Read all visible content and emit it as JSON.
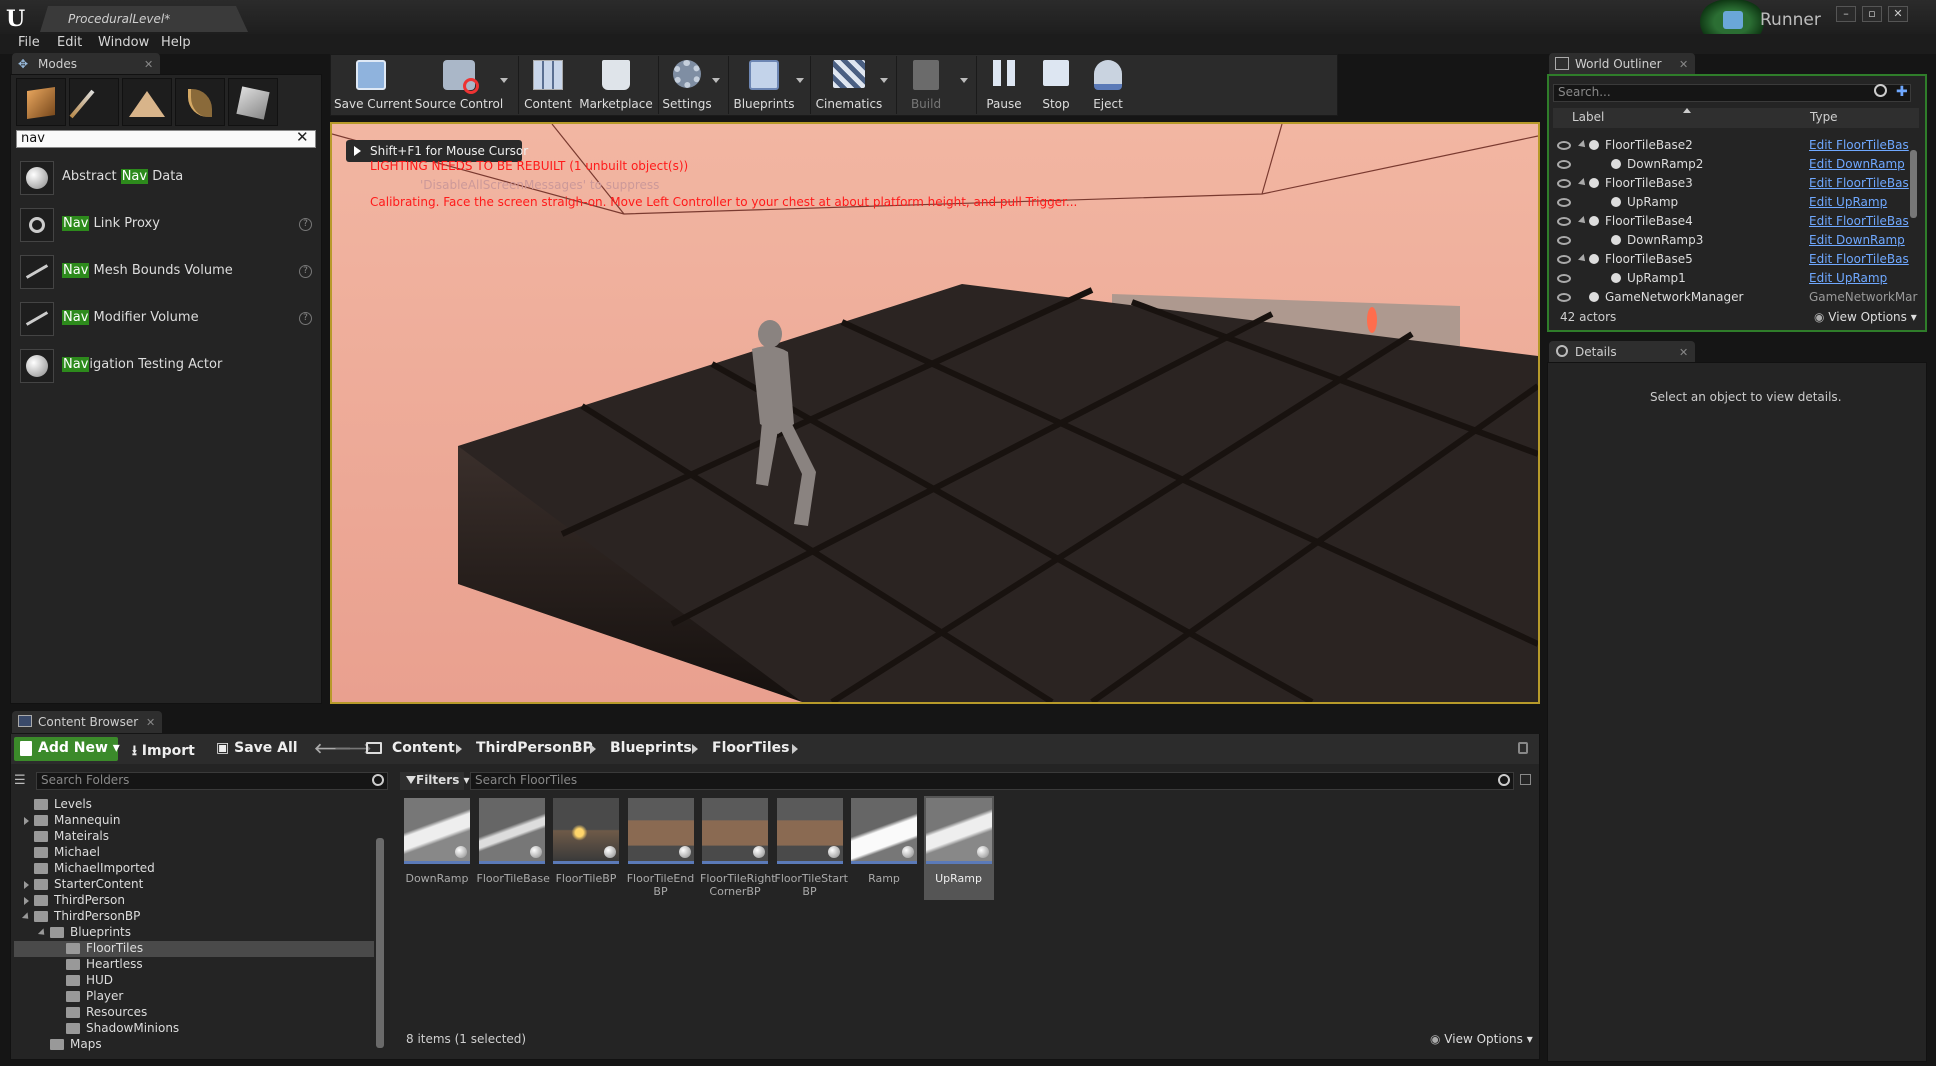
{
  "app": {
    "doc_tab": "ProceduralLevel*",
    "play_label": "Runner"
  },
  "menu": [
    "File",
    "Edit",
    "Window",
    "Help"
  ],
  "modes": {
    "tab": "Modes",
    "search_value": "nav",
    "items": [
      {
        "pre": "Abstract ",
        "hl": "Nav",
        "post": " Data",
        "help": false
      },
      {
        "pre": "",
        "hl": "Nav",
        "post": " Link Proxy",
        "help": true
      },
      {
        "pre": "",
        "hl": "Nav",
        "post": " Mesh Bounds Volume",
        "help": true
      },
      {
        "pre": "",
        "hl": "Nav",
        "post": " Modifier Volume",
        "help": true
      },
      {
        "pre": "",
        "hl": "Nav",
        "post": "igation Testing Actor",
        "help": false
      }
    ]
  },
  "toolbar": {
    "save_current": "Save Current",
    "source_control": "Source Control",
    "content": "Content",
    "marketplace": "Marketplace",
    "settings": "Settings",
    "blueprints": "Blueprints",
    "cinematics": "Cinematics",
    "build": "Build",
    "pause": "Pause",
    "stop": "Stop",
    "eject": "Eject"
  },
  "viewport": {
    "hint": "Shift+F1 for Mouse Cursor",
    "msg_lighting": "LIGHTING NEEDS TO BE REBUILT (1 unbuilt object(s))",
    "msg_disable": "'DisableAllScreenMessages' to suppress",
    "msg_calibrating": "Calibrating. Face the screen straigh-on. Move Left Controller to your chest at about platform height, and pull Trigger..."
  },
  "outliner": {
    "tab": "World Outliner",
    "search_placeholder": "Search...",
    "col_label": "Label",
    "col_type": "Type",
    "rows": [
      {
        "name": "FloorTileBase2",
        "type": "Edit FloorTileBas",
        "indent": 1,
        "link": true
      },
      {
        "name": "DownRamp2",
        "type": "Edit DownRamp",
        "indent": 2,
        "link": true
      },
      {
        "name": "FloorTileBase3",
        "type": "Edit FloorTileBas",
        "indent": 1,
        "link": true
      },
      {
        "name": "UpRamp",
        "type": "Edit UpRamp",
        "indent": 2,
        "link": true
      },
      {
        "name": "FloorTileBase4",
        "type": "Edit FloorTileBas",
        "indent": 1,
        "link": true
      },
      {
        "name": "DownRamp3",
        "type": "Edit DownRamp",
        "indent": 2,
        "link": true
      },
      {
        "name": "FloorTileBase5",
        "type": "Edit FloorTileBas",
        "indent": 1,
        "link": true
      },
      {
        "name": "UpRamp1",
        "type": "Edit UpRamp",
        "indent": 2,
        "link": true
      },
      {
        "name": "GameNetworkManager",
        "type": "GameNetworkMar",
        "indent": 1,
        "link": false
      }
    ],
    "actor_count": "42 actors",
    "view_options": "View Options"
  },
  "details": {
    "tab": "Details",
    "empty_text": "Select an object to view details."
  },
  "content_browser": {
    "tab": "Content Browser",
    "add_new": "Add New",
    "import": "Import",
    "save_all": "Save All",
    "breadcrumb": [
      "Content",
      "ThirdPersonBP",
      "Blueprints",
      "FloorTiles"
    ],
    "folder_search_placeholder": "Search Folders",
    "filters": "Filters",
    "asset_search_placeholder": "Search FloorTiles",
    "folders": [
      {
        "name": "Levels",
        "depth": 0,
        "arrow": false,
        "open": false,
        "selected": false
      },
      {
        "name": "Mannequin",
        "depth": 0,
        "arrow": true,
        "open": false,
        "selected": false
      },
      {
        "name": "Mateirals",
        "depth": 0,
        "arrow": false,
        "open": false,
        "selected": false
      },
      {
        "name": "Michael",
        "depth": 0,
        "arrow": false,
        "open": false,
        "selected": false
      },
      {
        "name": "MichaelImported",
        "depth": 0,
        "arrow": false,
        "open": false,
        "selected": false
      },
      {
        "name": "StarterContent",
        "depth": 0,
        "arrow": true,
        "open": false,
        "selected": false
      },
      {
        "name": "ThirdPerson",
        "depth": 0,
        "arrow": true,
        "open": false,
        "selected": false
      },
      {
        "name": "ThirdPersonBP",
        "depth": 0,
        "arrow": true,
        "open": true,
        "selected": false
      },
      {
        "name": "Blueprints",
        "depth": 1,
        "arrow": true,
        "open": true,
        "selected": false
      },
      {
        "name": "FloorTiles",
        "depth": 2,
        "arrow": false,
        "open": false,
        "selected": true
      },
      {
        "name": "Heartless",
        "depth": 2,
        "arrow": false,
        "open": false,
        "selected": false
      },
      {
        "name": "HUD",
        "depth": 2,
        "arrow": false,
        "open": false,
        "selected": false
      },
      {
        "name": "Player",
        "depth": 2,
        "arrow": false,
        "open": false,
        "selected": false
      },
      {
        "name": "Resources",
        "depth": 2,
        "arrow": false,
        "open": false,
        "selected": false
      },
      {
        "name": "ShadowMinions",
        "depth": 2,
        "arrow": false,
        "open": false,
        "selected": false
      },
      {
        "name": "Maps",
        "depth": 1,
        "arrow": false,
        "open": false,
        "selected": false
      }
    ],
    "assets": [
      {
        "name": "DownRamp",
        "kind": "ramp",
        "selected": false
      },
      {
        "name": "FloorTileBase",
        "kind": "plain",
        "selected": false
      },
      {
        "name": "FloorTileBP",
        "kind": "glow",
        "selected": false
      },
      {
        "name": "FloorTileEnd BP",
        "kind": "wall",
        "selected": false
      },
      {
        "name": "FloorTileRight CornerBP",
        "kind": "wall",
        "selected": false
      },
      {
        "name": "FloorTileStart BP",
        "kind": "wall",
        "selected": false
      },
      {
        "name": "Ramp",
        "kind": "white",
        "selected": false
      },
      {
        "name": "UpRamp",
        "kind": "ramp",
        "selected": true
      }
    ],
    "items_count": "8 items (1 selected)",
    "view_options": "View Options"
  },
  "colors": {
    "accent_green": "#3b8a2a",
    "link_blue": "#6fa8ff",
    "viewport_border": "#b79a2a",
    "error_red": "#ff1a1a"
  }
}
